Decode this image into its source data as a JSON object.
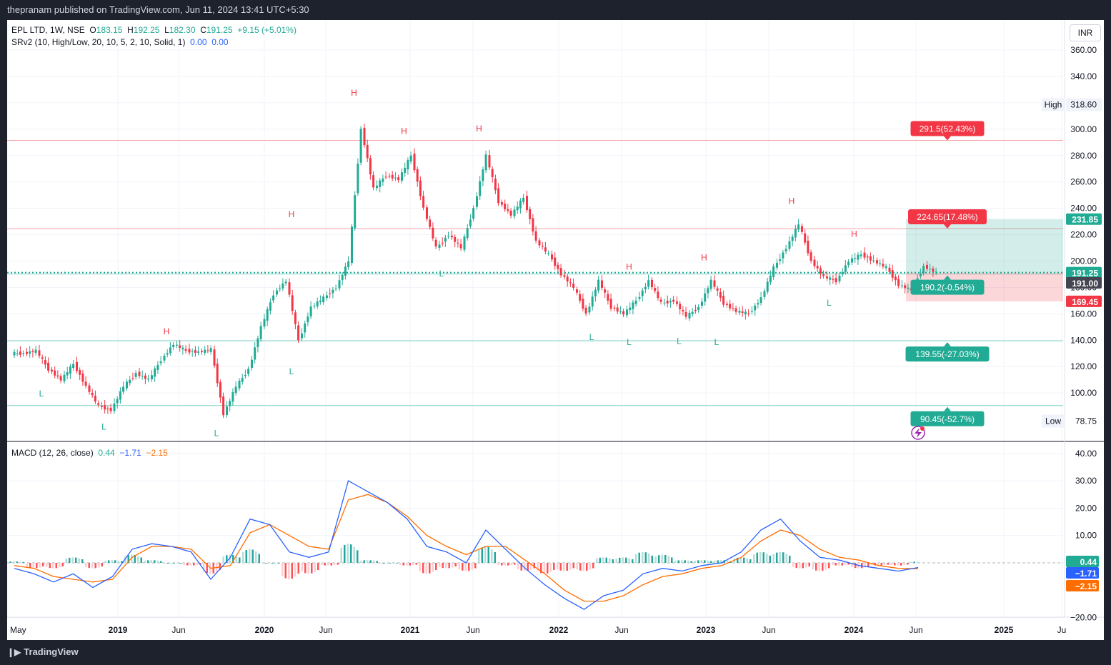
{
  "header": {
    "publisher": "thepranam published on TradingView.com, Jun 11, 2024 13:41 UTC+5:30"
  },
  "footer": {
    "brand": "TradingView"
  },
  "legend": {
    "symbol": "EPL LTD, 1W, NSE",
    "o_label": "O",
    "o": "183.15",
    "h_label": "H",
    "h": "192.25",
    "l_label": "L",
    "l": "182.30",
    "c_label": "C",
    "c": "191.25",
    "change": "+9.15 (+5.01%)",
    "indicator": "SRv2 (10, High/Low, 20, 10, 5, 2, 10, Solid, 1)",
    "ind_v1": "0.00",
    "ind_v2": "0.00",
    "macd_label": "MACD (12, 26, close)",
    "macd_hist": "0.44",
    "macd_line": "−1.71",
    "macd_signal": "−2.15"
  },
  "currency": "INR",
  "colors": {
    "up": "#22ab94",
    "down": "#f23645",
    "macd": "#2962ff",
    "signal": "#ff6d00",
    "target": "#22ab94",
    "stop": "#f23645"
  },
  "chart_data": [
    {
      "type": "candlestick",
      "symbol": "EPL LTD",
      "interval": "1W",
      "exchange": "NSE",
      "ylim": [
        70,
        370
      ],
      "y_ticks": [
        100,
        120,
        140,
        160,
        180,
        200,
        220,
        240,
        260,
        280,
        300,
        320,
        340,
        360
      ],
      "y_tick_labels": [
        "100.00",
        "120.00",
        "140.00",
        "160.00",
        "180.00",
        "200.00",
        "220.00",
        "240.00",
        "260.00",
        "280.00",
        "300.00",
        "320.00",
        "340.00",
        "360.00"
      ],
      "x_ticks": [
        "May",
        "2019",
        "Jun",
        "2020",
        "Jun",
        "2021",
        "Jun",
        "2022",
        "Jun",
        "2023",
        "Jun",
        "2024",
        "Jun",
        "2025",
        "Ju"
      ],
      "series": [
        {
          "name": "close (approx, weekly)",
          "points": [
            [
              "2018-05",
              130
            ],
            [
              "2018-06",
              132
            ],
            [
              "2018-07",
              118
            ],
            [
              "2018-08",
              110
            ],
            [
              "2018-09",
              122
            ],
            [
              "2018-10",
              105
            ],
            [
              "2018-11",
              90
            ],
            [
              "2018-12",
              87
            ],
            [
              "2019-01",
              105
            ],
            [
              "2019-02",
              115
            ],
            [
              "2019-03",
              110
            ],
            [
              "2019-04",
              125
            ],
            [
              "2019-05",
              137
            ],
            [
              "2019-06",
              132
            ],
            [
              "2019-07",
              131
            ],
            [
              "2019-08",
              133
            ],
            [
              "2019-09",
              84
            ],
            [
              "2019-10",
              105
            ],
            [
              "2019-11",
              118
            ],
            [
              "2019-12",
              150
            ],
            [
              "2020-01",
              175
            ],
            [
              "2020-02",
              185
            ],
            [
              "2020-03",
              140
            ],
            [
              "2020-04",
              165
            ],
            [
              "2020-05",
              172
            ],
            [
              "2020-06",
              180
            ],
            [
              "2020-07",
              200
            ],
            [
              "2020-08",
              300
            ],
            [
              "2020-09",
              255
            ],
            [
              "2020-10",
              265
            ],
            [
              "2020-11",
              262
            ],
            [
              "2020-12",
              280
            ],
            [
              "2021-01",
              240
            ],
            [
              "2021-02",
              210
            ],
            [
              "2021-03",
              220
            ],
            [
              "2021-04",
              210
            ],
            [
              "2021-05",
              240
            ],
            [
              "2021-06",
              280
            ],
            [
              "2021-07",
              245
            ],
            [
              "2021-08",
              235
            ],
            [
              "2021-09",
              248
            ],
            [
              "2021-10",
              215
            ],
            [
              "2021-11",
              205
            ],
            [
              "2021-12",
              190
            ],
            [
              "2022-01",
              180
            ],
            [
              "2022-02",
              160
            ],
            [
              "2022-03",
              185
            ],
            [
              "2022-04",
              165
            ],
            [
              "2022-05",
              160
            ],
            [
              "2022-06",
              170
            ],
            [
              "2022-07",
              185
            ],
            [
              "2022-08",
              168
            ],
            [
              "2022-09",
              170
            ],
            [
              "2022-10",
              158
            ],
            [
              "2022-11",
              165
            ],
            [
              "2022-12",
              185
            ],
            [
              "2023-01",
              168
            ],
            [
              "2023-02",
              162
            ],
            [
              "2023-03",
              160
            ],
            [
              "2023-04",
              172
            ],
            [
              "2023-05",
              195
            ],
            [
              "2023-06",
              210
            ],
            [
              "2023-07",
              228
            ],
            [
              "2023-08",
              200
            ],
            [
              "2023-09",
              188
            ],
            [
              "2023-10",
              185
            ],
            [
              "2023-11",
              200
            ],
            [
              "2023-12",
              205
            ],
            [
              "2024-01",
              200
            ],
            [
              "2024-02",
              195
            ],
            [
              "2024-03",
              182
            ],
            [
              "2024-04",
              178
            ],
            [
              "2024-05",
              196
            ],
            [
              "2024-06",
              191.25
            ]
          ]
        }
      ],
      "annotations": {
        "swing_high_label": "H",
        "swing_low_label": "L",
        "high_marker": {
          "label": "High",
          "value": "318.60"
        },
        "low_marker": {
          "label": "Low",
          "value": "78.75"
        },
        "levels": [
          {
            "label": "291.5(52.43%)",
            "value": 291.5,
            "kind": "resistance"
          },
          {
            "label": "224.65(17.48%)",
            "value": 224.65,
            "kind": "resistance"
          },
          {
            "label": "190.2(-0.54%)",
            "value": 190.2,
            "kind": "support"
          },
          {
            "label": "139.55(-27.03%)",
            "value": 139.55,
            "kind": "support"
          },
          {
            "label": "90.45(-52.7%)",
            "value": 90.45,
            "kind": "support"
          }
        ],
        "price_tags": {
          "target": "231.85",
          "last": "191.25",
          "countdown": "3d 2h",
          "entry": "191.00",
          "stop": "169.45"
        }
      }
    },
    {
      "type": "line",
      "title": "MACD (12, 26, close)",
      "ylim": [
        -20,
        40
      ],
      "y_tick_labels": [
        "−20.00",
        "0.00",
        "10.00",
        "20.00",
        "30.00",
        "40.00"
      ],
      "series": [
        {
          "name": "MACD",
          "values": [
            -2,
            -4,
            -7,
            -4,
            -9,
            -5,
            5,
            7,
            6,
            4,
            -6,
            2,
            16,
            14,
            4,
            2,
            4,
            30,
            26,
            22,
            16,
            6,
            4,
            0,
            12,
            5,
            -2,
            -8,
            -13,
            -17,
            -12,
            -10,
            -4,
            -2,
            -3,
            -1,
            0,
            4,
            12,
            16,
            8,
            2,
            1,
            -1,
            -2,
            -3,
            -1.71
          ]
        },
        {
          "name": "Signal",
          "values": [
            -1,
            -2,
            -5,
            -6,
            -7,
            -6,
            2,
            6,
            6,
            5,
            -2,
            -1,
            11,
            14,
            10,
            6,
            5,
            23,
            25,
            22,
            17,
            10,
            6,
            3,
            6,
            6,
            1,
            -4,
            -10,
            -14,
            -14,
            -12,
            -8,
            -5,
            -4,
            -2,
            -1,
            2,
            8,
            12,
            10,
            5,
            2,
            1,
            -1,
            -2,
            -2.15
          ]
        },
        {
          "name": "Histogram",
          "values": [
            0.5,
            -2,
            -2,
            2,
            -2,
            1,
            3,
            1,
            0,
            -1,
            -4,
            3,
            5,
            0,
            -6,
            -4,
            -1,
            7,
            1,
            0,
            -1,
            -4,
            -2,
            -3,
            6,
            -1,
            -3,
            -4,
            -3,
            -3,
            2,
            2,
            4,
            3,
            1,
            1,
            1,
            2,
            4,
            4,
            -2,
            -3,
            -1,
            -2,
            -1,
            -1,
            0.44
          ]
        }
      ]
    }
  ]
}
